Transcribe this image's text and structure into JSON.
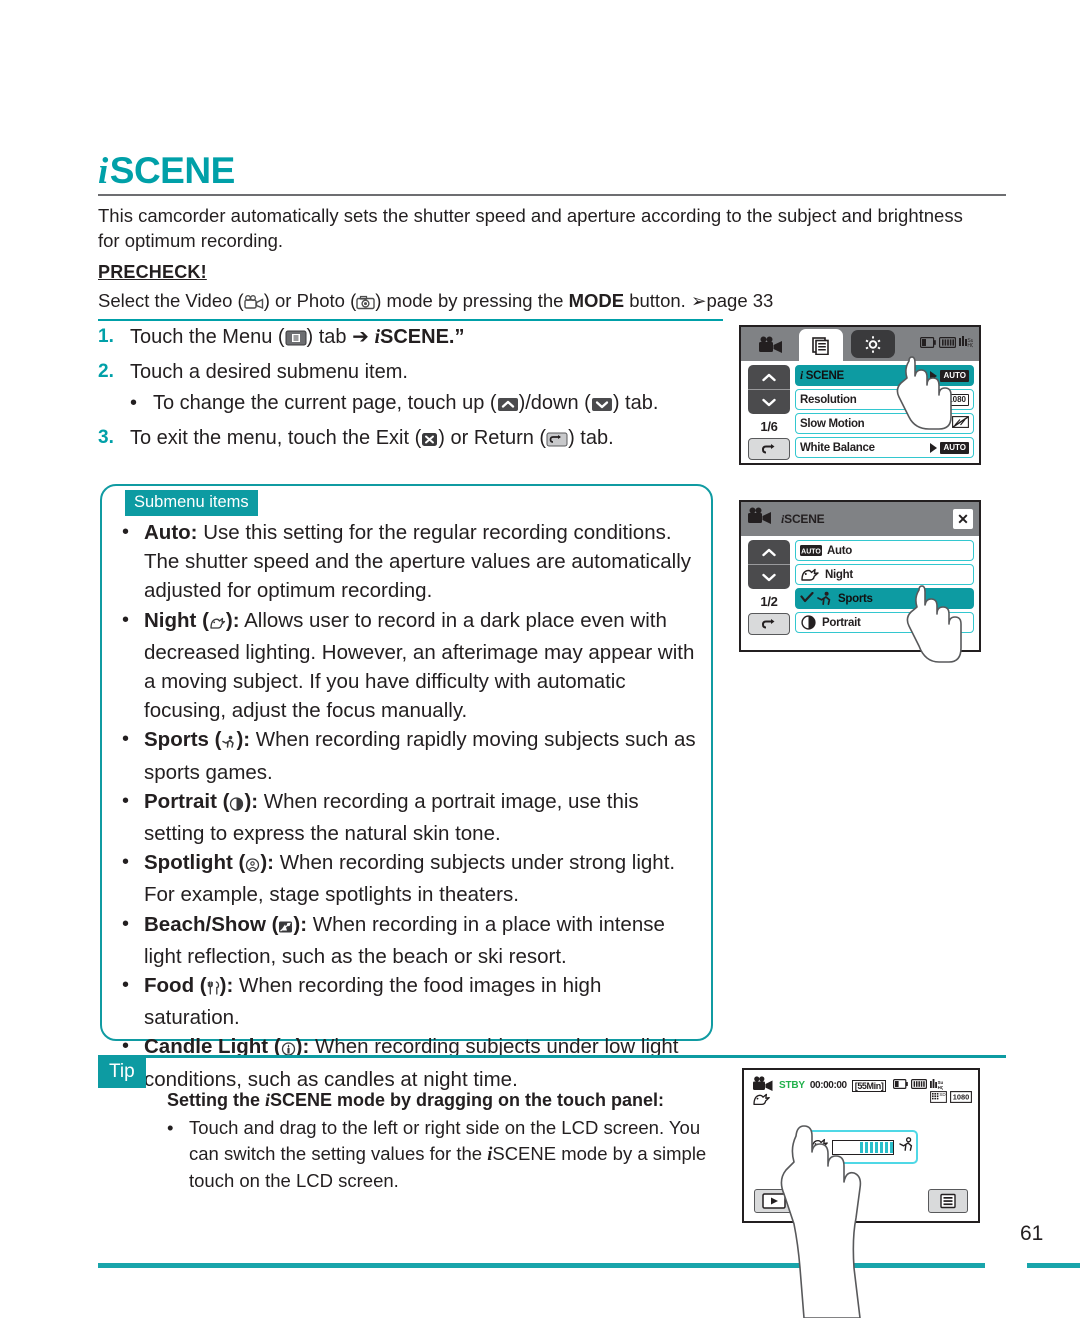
{
  "page": {
    "number": "61",
    "accent_color": "#0d9ba2",
    "title": "SCENE",
    "title_prefix_glyph": "i"
  },
  "intro": {
    "text": "This camcorder automatically sets the shutter speed and aperture according to the subject and brightness for optimum recording."
  },
  "precheck": {
    "heading": "PRECHECK!",
    "line_part1": "Select the Video (",
    "line_part2": ") or Photo (",
    "line_part3": ") mode by pressing the ",
    "mode_bold": "MODE",
    "line_part4": " button. ",
    "page_ref": "page 33"
  },
  "steps": [
    {
      "num": "1.",
      "part1": "Touch the Menu (",
      "part2": ") tab ",
      "arrow": "➔",
      "part3": " ",
      "target_italic": "i",
      "target_bold": "SCENE.”"
    },
    {
      "num": "2.",
      "text": "Touch a desired submenu item."
    },
    {
      "num": "3.",
      "part1": "To exit the menu, touch the Exit (",
      "part2": ") or Return (",
      "part3": ") tab."
    }
  ],
  "substep": {
    "part1": "To change the current page, touch up (",
    "part2": ")/down (",
    "part3": ") tab."
  },
  "submenu": {
    "tag": "Submenu items",
    "items": [
      {
        "name": "Auto",
        "icon": "none",
        "bold": "Auto:",
        "text": " Use this setting for the regular recording conditions. The shutter speed and the aperture values are automatically adjusted for optimum recording."
      },
      {
        "name": "Night",
        "icon": "night-icon",
        "bold_pre": "Night (",
        "bold_post": "):",
        "text": " Allows user to record in a dark place even with decreased lighting. However, an afterimage may appear with a moving subject. If you have difficulty with automatic focusing, adjust the focus manually."
      },
      {
        "name": "Sports",
        "icon": "sports-icon",
        "bold_pre": "Sports (",
        "bold_post": "):",
        "text": " When recording rapidly moving subjects such as sports games."
      },
      {
        "name": "Portrait",
        "icon": "portrait-icon",
        "bold_pre": "Portrait (",
        "bold_post": "):",
        "text": " When recording a portrait image, use this setting to express the natural skin tone."
      },
      {
        "name": "Spotlight",
        "icon": "spotlight-icon",
        "bold_pre": "Spotlight (",
        "bold_post": "):",
        "text": " When recording subjects under strong light. For example, stage spotlights in theaters."
      },
      {
        "name": "Beach/Show",
        "icon": "beach-icon",
        "bold_pre": "Beach/Show (",
        "bold_post": "):",
        "text": " When recording in a place with intense light reflection, such as the beach or ski resort."
      },
      {
        "name": "Food",
        "icon": "food-icon",
        "bold_pre": "Food (",
        "bold_post": "):",
        "text": " When recording the food images in high saturation."
      },
      {
        "name": "Candle Light",
        "icon": "candle-icon",
        "bold_pre": "Candle Light (",
        "bold_post": "):",
        "text": " When recording subjects under low light conditions, such as candles at night time."
      }
    ]
  },
  "tip": {
    "tag": "Tip",
    "title_part1": "Setting the ",
    "title_italic": "i",
    "title_part2": "SCENE mode by dragging on the touch panel:",
    "body_part1": "Touch and drag to the left or right side on the LCD screen. You can switch the setting values for the ",
    "body_italic": "i",
    "body_part2": "SCENE mode by a simple touch on the LCD screen."
  },
  "lcd1": {
    "tabs": [
      "video-camera-tab",
      "menu-tab",
      "settings-tab"
    ],
    "status_icons": [
      "battery-icon",
      "memory-icon",
      "quality-icon"
    ],
    "page_indicator": "1/6",
    "rows": [
      {
        "label_italic": "i",
        "label": " SCENE",
        "selected": true,
        "arrow": true,
        "badge": "AUTO",
        "badge_style": "dark"
      },
      {
        "label": "Resolution",
        "selected": false,
        "arrow": false,
        "badge": "1080",
        "badge_style": "light"
      },
      {
        "label": "Slow Motion",
        "selected": false,
        "arrow": true,
        "badge": "slowmo",
        "badge_style": "light"
      },
      {
        "label": "White Balance",
        "selected": false,
        "arrow": true,
        "badge": "AUTO",
        "badge_style": "dark"
      }
    ]
  },
  "lcd2": {
    "title_italic": "i",
    "title": "SCENE",
    "close_label": "✕",
    "page_indicator": "1/2",
    "rows": [
      {
        "label": "Auto",
        "icon": "auto-badge",
        "selected": false,
        "check": false
      },
      {
        "label": "Night",
        "icon": "night-icon",
        "selected": false,
        "check": false
      },
      {
        "label": "Sports",
        "icon": "sports-icon",
        "selected": true,
        "check": true
      },
      {
        "label": "Portrait",
        "icon": "portrait-icon",
        "selected": false,
        "check": false
      }
    ]
  },
  "lcd3": {
    "status": "STBY",
    "timecode": "00:00:00",
    "remaining": "[55Min]",
    "mode_icon": "night-icon",
    "status_icons": [
      "battery-icon",
      "memory-icon",
      "quality-icon",
      "sd-icon",
      "res-1080-icon"
    ],
    "play_icon": "play-icon",
    "menu_icon": "menu-icon"
  }
}
